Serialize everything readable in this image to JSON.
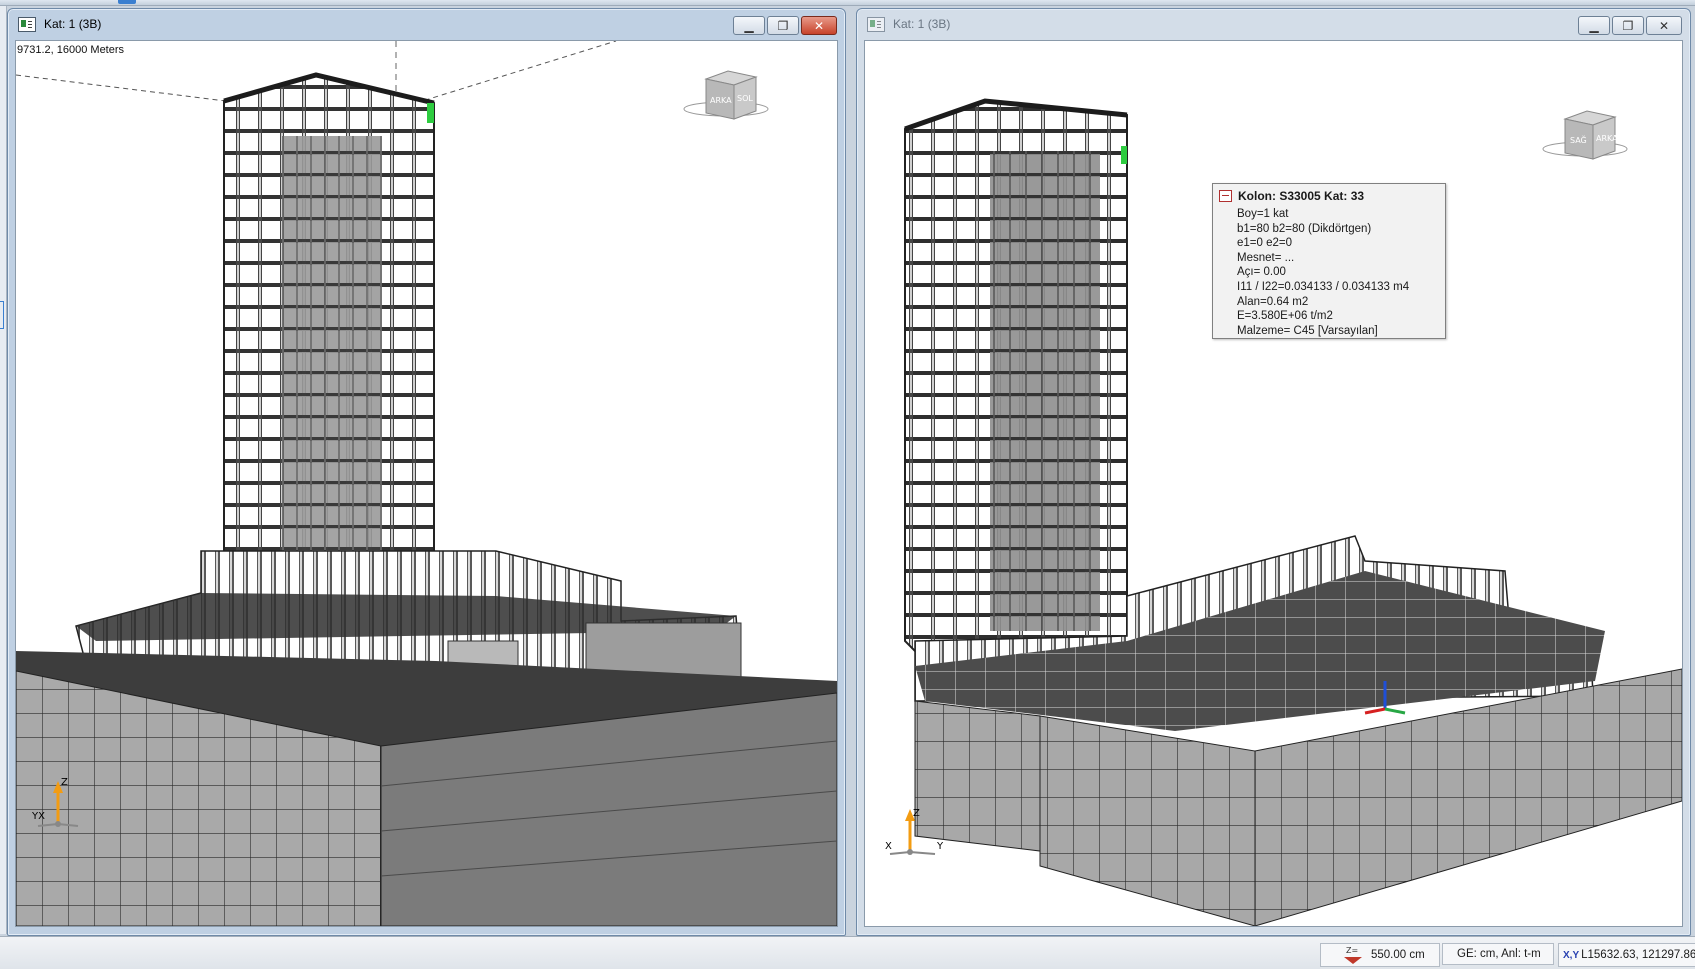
{
  "windows": [
    {
      "title": "Kat: 1 (3B)",
      "active": true,
      "coord_text": "9731.2, 16000 Meters",
      "view_cube": {
        "left_face": "ARKA",
        "right_face": "SOL"
      },
      "axes": {
        "up": "Z",
        "left": "YX"
      }
    },
    {
      "title": "Kat: 1 (3B)",
      "active": false,
      "view_cube": {
        "left_face": "SAĞ",
        "right_face": "ARKA"
      },
      "axes": {
        "up": "Z",
        "left": "X",
        "right": "Y"
      },
      "tooltip": {
        "title": "Kolon: S33005 Kat: 33",
        "lines": [
          "Boy=1 kat",
          "b1=80  b2=80  (Dikdörtgen)",
          "e1=0  e2=0",
          "Mesnet= ...",
          "Açı= 0.00",
          "I11 / I22=0.034133 / 0.034133 m4",
          "Alan=0.64 m2",
          "E=3.580E+06 t/m2",
          "Malzeme= C45 [Varsayılan]"
        ]
      }
    }
  ],
  "statusbar": {
    "z_label": "Z=",
    "z_value": "550.00 cm",
    "units": "GE: cm,  Anl: t-m",
    "xy_label": "X,Y",
    "xy_value": "L15632.63, 121297.86"
  },
  "colors": {
    "steel_frame": "#2b2b2b",
    "slab_dark": "#3a3a3a",
    "facade_gray": "#a6a6a6",
    "selected_column": "#2ecc40",
    "axis_z": "#f39c12"
  }
}
